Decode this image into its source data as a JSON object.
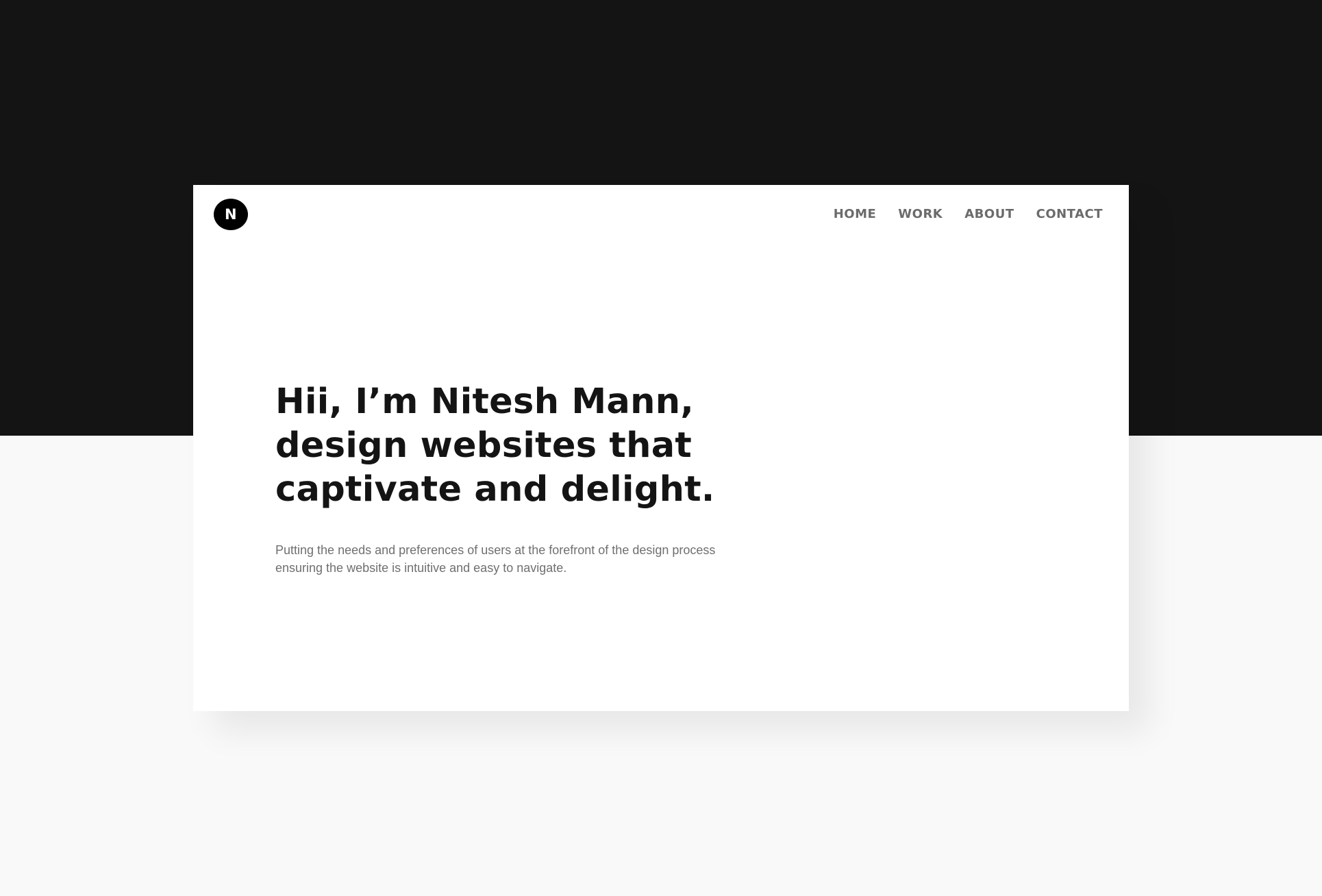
{
  "logo": {
    "letter": "N"
  },
  "nav": {
    "items": [
      {
        "label": "HOME"
      },
      {
        "label": "WORK"
      },
      {
        "label": "ABOUT"
      },
      {
        "label": "CONTACT"
      }
    ]
  },
  "hero": {
    "title": "Hii, I’m Nitesh Mann, design websites that captivate and delight.",
    "subtitle": "Putting the needs and preferences of users at the forefront of the design process ensuring the website is intuitive and easy to navigate."
  },
  "colors": {
    "dark_band": "#141414",
    "page_background": "#f9f9f9",
    "card_background": "#ffffff",
    "nav_text": "#6b6b6b",
    "heading_text": "#141414",
    "body_text": "#6f6f6f"
  }
}
